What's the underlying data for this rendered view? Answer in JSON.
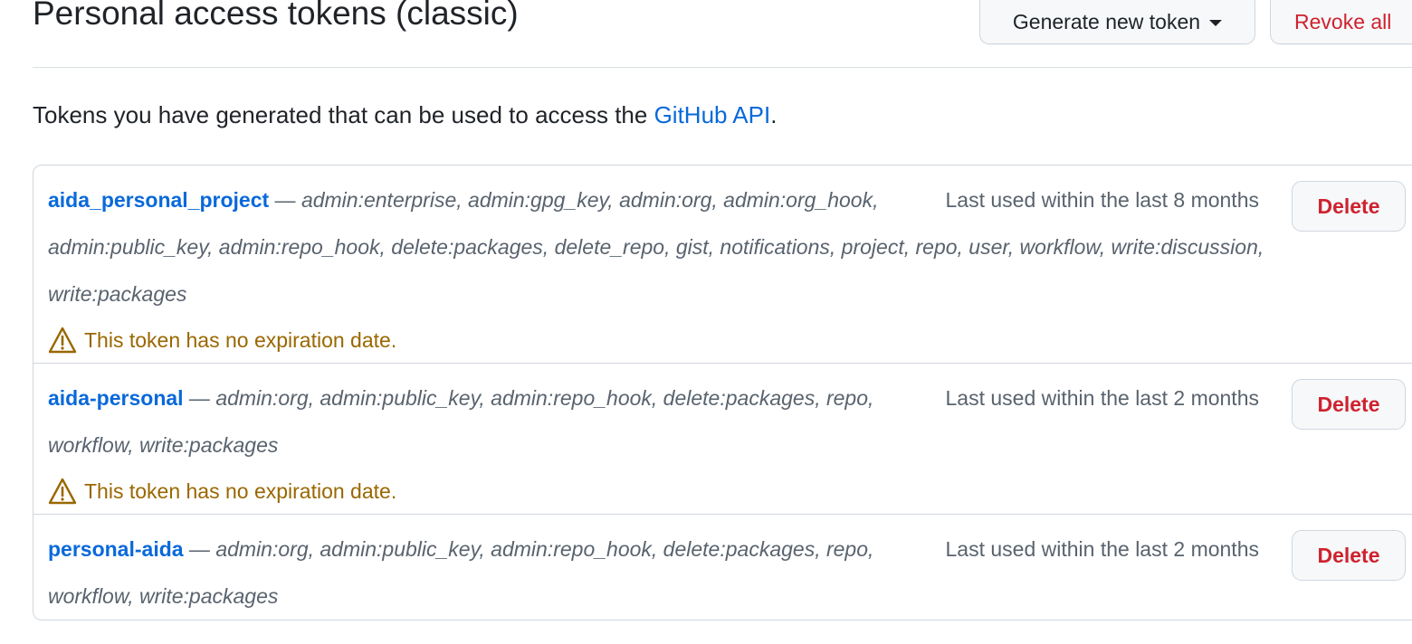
{
  "header": {
    "title": "Personal access tokens (classic)",
    "generate_label": "Generate new token",
    "revoke_label": "Revoke all"
  },
  "intro": {
    "text": "Tokens you have generated that can be used to access the ",
    "link": "GitHub API",
    "suffix": "."
  },
  "tokens": [
    {
      "name": "aida_personal_project",
      "dash": " — ",
      "scopes": "admin:enterprise, admin:gpg_key, admin:org, admin:org_hook, admin:public_key, admin:repo_hook, delete:packages, delete_repo, gist, notifications, project, repo, user, workflow, write:discussion, write:packages",
      "last_used": "Last used within the last 8 months",
      "warning": "This token has no expiration date.",
      "delete_label": "Delete"
    },
    {
      "name": "aida-personal",
      "dash": " — ",
      "scopes": "admin:org, admin:public_key, admin:repo_hook, delete:packages, repo, workflow, write:packages",
      "last_used": "Last used within the last 2 months",
      "warning": "This token has no expiration date.",
      "delete_label": "Delete"
    },
    {
      "name": "personal-aida",
      "dash": " — ",
      "scopes": "admin:org, admin:public_key, admin:repo_hook, delete:packages, repo, workflow, write:packages",
      "last_used": "Last used within the last 2 months",
      "warning": "",
      "delete_label": "Delete"
    }
  ],
  "icons": {
    "caret": "triangle-down-icon",
    "warning": "alert-triangle-icon"
  },
  "colors": {
    "link": "#0969da",
    "danger": "#cf222e",
    "attention": "#9a6700",
    "muted": "#59636e",
    "border": "#d0d7de"
  }
}
